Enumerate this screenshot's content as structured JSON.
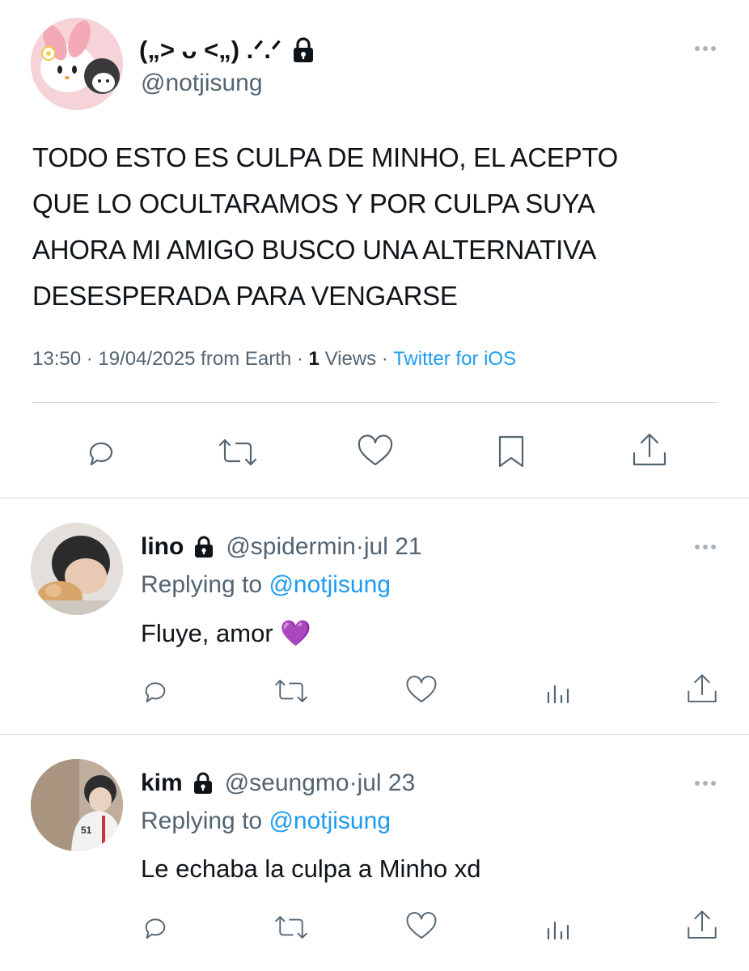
{
  "main_tweet": {
    "display_name": "(„> ᴗ <„) .ᐟ.ᐟ",
    "handle": "@notjisung",
    "text_lines": [
      "TODO ESTO ES CULPA DE MINHO, EL ACEPTO",
      "QUE LO OCULTARAMOS Y POR CULPA SUYA",
      "AHORA MI AMIGO BUSCO UNA ALTERNATIVA",
      "DESESPERADA PARA VENGARSE"
    ],
    "meta": {
      "time": "13:50",
      "sep1": " · ",
      "date": "19/04/2025",
      "from": " from Earth",
      "sep2": " · ",
      "views_count": "1",
      "views_label": " Views",
      "sep3": " · ",
      "client": "Twitter for iOS"
    }
  },
  "replies": [
    {
      "display_name": "lino",
      "handle": "@spidermin",
      "sep": " · ",
      "date": "jul 21",
      "replying_label": "Replying to ",
      "replying_to": "@notjisung",
      "text": "Fluye, amor 💜"
    },
    {
      "display_name": "kim",
      "handle": "@seungmo",
      "sep": " · ",
      "date": "jul 23",
      "replying_label": "Replying to ",
      "replying_to": "@notjisung",
      "text": "Le echaba la culpa a Minho xd"
    }
  ],
  "icons": {
    "lock": "lock-icon",
    "more": "more-icon",
    "reply": "reply-icon",
    "retweet": "retweet-icon",
    "like": "like-icon",
    "bookmark": "bookmark-icon",
    "share": "share-icon",
    "analytics": "analytics-icon"
  },
  "colors": {
    "text": "#0f1419",
    "muted": "#536471",
    "accent": "#1d9bf0",
    "divider": "#cfd9de"
  }
}
